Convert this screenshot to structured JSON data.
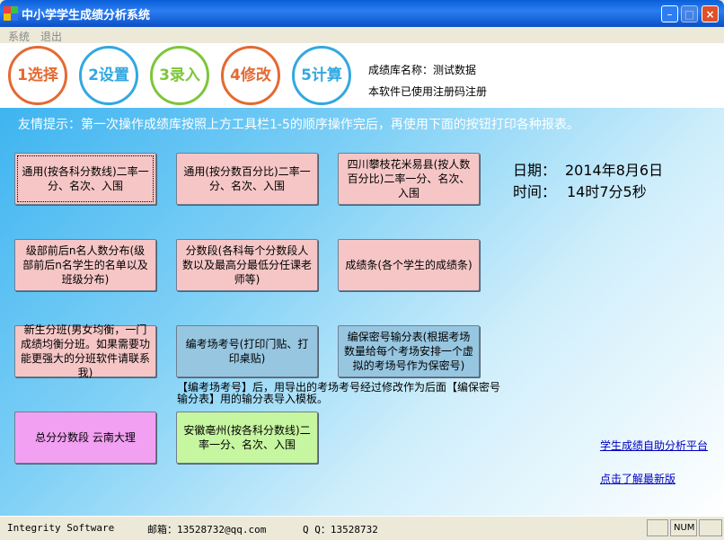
{
  "window": {
    "title": "中小学学生成绩分析系统"
  },
  "menu": {
    "items": [
      "系统",
      "退出"
    ]
  },
  "toolbar": {
    "buttons": [
      {
        "label": "1选择",
        "color": "#E46A33"
      },
      {
        "label": "2设置",
        "color": "#33A8E0"
      },
      {
        "label": "3录入",
        "color": "#7EC63A"
      },
      {
        "label": "4修改",
        "color": "#E46A33"
      },
      {
        "label": "5计算",
        "color": "#33A8E0"
      }
    ],
    "db_name": "成绩库名称：测试数据",
    "reg_status": "本软件已使用注册码注册"
  },
  "tip": "友情提示：第一次操作成绩库按照上方工具栏1-5的顺序操作完后，再使用下面的按钮打印各种报表。",
  "reports": {
    "r1": "通用(按各科分数线)二率一分、名次、入围",
    "r2": "通用(按分数百分比)二率一分、名次、入围",
    "r3": "四川攀枝花米易县(按人数百分比)二率一分、名次、入围",
    "r4": "级部前后n名人数分布(级部前后n名学生的名单以及班级分布)",
    "r5": "分数段(各科每个分数段人数以及最高分最低分任课老师等)",
    "r6": "成绩条(各个学生的成绩条)",
    "r7": "新生分班(男女均衡，一门成绩均衡分班。如果需要功能更强大的分班软件请联系我)",
    "r8": "编考场考号(打印门贴、打印桌贴)",
    "r9": "编保密号输分表(根据考场数量给每个考场安排一个虚拟的考场号作为保密号)",
    "r10": "总分分数段 云南大理",
    "r11": "安徽亳州(按各科分数线)二率一分、名次、入围"
  },
  "note": "【编考场考号】后，用导出的考场考号经过修改作为后面【编保密号输分表】用的输分表导入模板。",
  "datetime": {
    "date_label": "日期：",
    "date_value": "2014年8月6日",
    "time_label": "时间：",
    "time_value": "14时7分5秒"
  },
  "links": {
    "platform": "学生成绩自助分析平台",
    "newest": "点击了解最新版"
  },
  "status": {
    "company": "Integrity Software",
    "email": "邮箱：13528732@qq.com",
    "qq": "Q  Q：13528732",
    "num": "NUM"
  }
}
